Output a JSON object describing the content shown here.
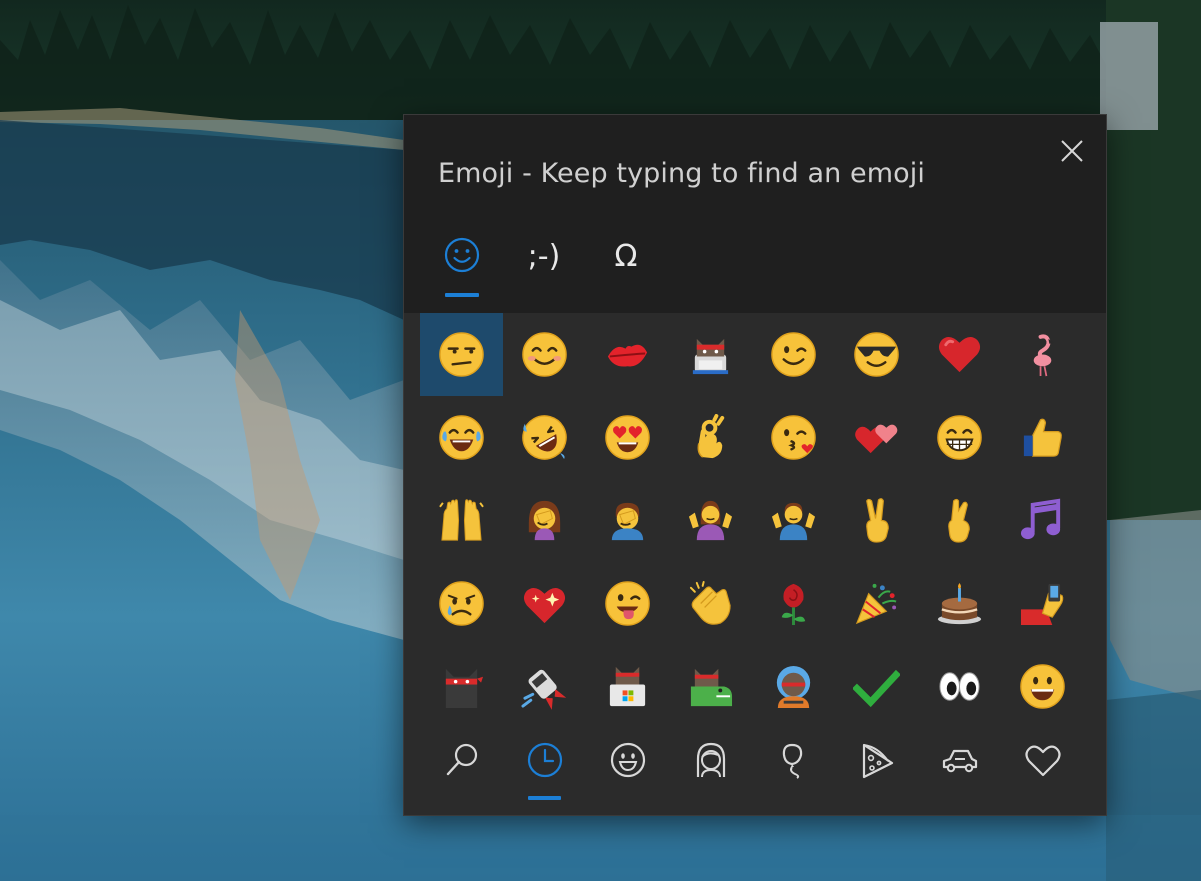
{
  "window": {
    "title": "Emoji - Keep typing to find an emoji",
    "close_icon": "close-icon"
  },
  "mode_tabs": [
    {
      "name": "emoji",
      "glyph": "",
      "icon": "smiley-outline-icon",
      "active": true
    },
    {
      "name": "kaomoji",
      "glyph": ";-)",
      "icon": "",
      "active": false
    },
    {
      "name": "symbols",
      "glyph": "Ω",
      "icon": "",
      "active": false
    }
  ],
  "emoji_grid": [
    [
      "unamused-face",
      "smiling-face",
      "kiss-mark",
      "ninja-cat-stack",
      "winking-face",
      "face-with-sunglasses",
      "red-heart",
      "flamingo"
    ],
    [
      "face-with-tears-of-joy",
      "rolling-on-floor-laughing",
      "smiling-face-with-heart-eyes",
      "ok-hand",
      "face-blowing-a-kiss",
      "two-hearts",
      "grinning-face-with-smiling-eyes",
      "thumbs-up"
    ],
    [
      "raising-hands",
      "woman-facepalming",
      "man-facepalming",
      "woman-shrugging",
      "man-shrugging",
      "victory-hand",
      "crossed-fingers",
      "musical-notes"
    ],
    [
      "crying-face",
      "sparkling-heart",
      "winking-face-with-tongue",
      "clapping-hands",
      "rose",
      "party-popper",
      "birthday-cake",
      "selfie"
    ],
    [
      "ninja-cat",
      "astro-cat",
      "hacker-cat",
      "dino-cat",
      "ninja-cat-astronaut",
      "check-mark",
      "eyes",
      "grinning-face"
    ]
  ],
  "selected_emoji": "unamused-face",
  "category_bar": [
    {
      "name": "search",
      "icon": "search-icon",
      "active": false
    },
    {
      "name": "recent",
      "icon": "clock-icon",
      "active": true
    },
    {
      "name": "smileys",
      "icon": "smiley-icon",
      "active": false
    },
    {
      "name": "people",
      "icon": "person-icon",
      "active": false
    },
    {
      "name": "celebrations",
      "icon": "balloon-icon",
      "active": false
    },
    {
      "name": "food",
      "icon": "pizza-icon",
      "active": false
    },
    {
      "name": "travel",
      "icon": "car-icon",
      "active": false
    },
    {
      "name": "symbols",
      "icon": "heart-icon",
      "active": false
    }
  ],
  "colors": {
    "panel_header": "#1f1f1f",
    "panel_body": "#2b2b2b",
    "accent": "#1c7fd6",
    "selected_cell": "#1e4a6c",
    "title_text": "#d0d0d0"
  }
}
